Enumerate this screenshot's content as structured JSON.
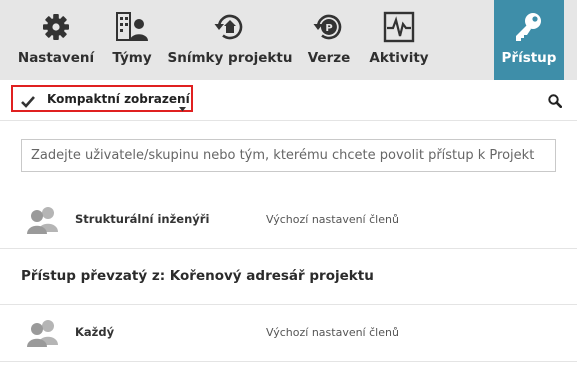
{
  "toolbar": {
    "items": [
      {
        "label": "Nastavení",
        "icon": "gear-icon"
      },
      {
        "label": "Týmy",
        "icon": "team-icon"
      },
      {
        "label": "Snímky projektu",
        "icon": "snapshot-icon"
      },
      {
        "label": "Verze",
        "icon": "version-icon"
      },
      {
        "label": "Aktivity",
        "icon": "activity-icon"
      },
      {
        "label": "Přístup",
        "icon": "key-icon",
        "active": true
      }
    ]
  },
  "subbar": {
    "compact_label": "Kompaktní zobrazení",
    "compact_checked": true
  },
  "search": {
    "placeholder": "Zadejte uživatele/skupinu nebo tým, kterému chcete povolit přístup k Projekt"
  },
  "members": [
    {
      "name": "Strukturální inženýři",
      "permission": "Výchozí nastavení členů"
    }
  ],
  "inherited": {
    "title": "Přístup převzatý z: Kořenový adresář projektu",
    "members": [
      {
        "name": "Každý",
        "permission": "Výchozí nastavení členů"
      }
    ]
  },
  "colors": {
    "toolbar_bg": "#e6e6e6",
    "active_tab": "#3e8ea9",
    "highlight_border": "#e02020"
  }
}
